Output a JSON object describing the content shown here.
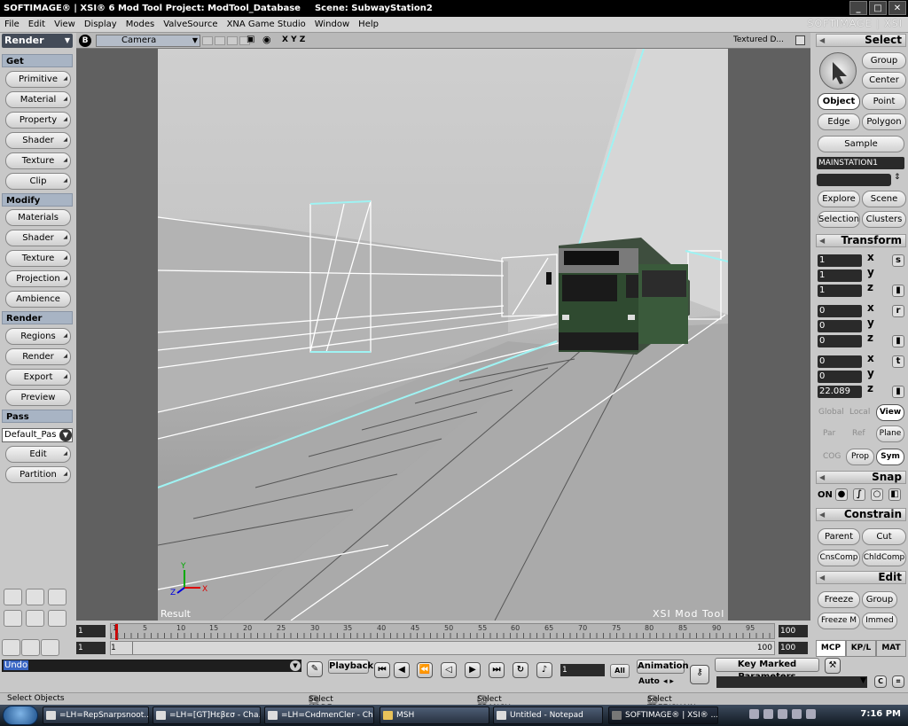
{
  "window": {
    "title": "SOFTIMAGE® | XSI® 6 Mod Tool Project: ModTool_Database",
    "scene": "Scene: SubwayStation2",
    "brand": "SOFTIMAGE | XSI"
  },
  "menu": [
    "File",
    "Edit",
    "View",
    "Display",
    "Modes",
    "ValveSource",
    "XNA Game Studio",
    "Window",
    "Help"
  ],
  "left_panel": {
    "mode": "Render",
    "sections": {
      "get": "Get",
      "modify": "Modify",
      "render": "Render",
      "pass": "Pass"
    },
    "get_buttons": [
      "Primitive",
      "Material",
      "Property",
      "Shader",
      "Texture",
      "Clip"
    ],
    "modify_buttons": [
      "Materials",
      "Shader",
      "Texture",
      "Projection",
      "Ambience"
    ],
    "render_buttons": [
      "Regions",
      "Render",
      "Export",
      "Preview"
    ],
    "pass_dropdown": "Default_Pas",
    "pass_buttons": [
      "Edit",
      "Partition"
    ]
  },
  "viewport": {
    "b_label": "B",
    "camera": "Camera",
    "axes": "X Y Z",
    "display_mode": "Textured D...",
    "label_left": "Result",
    "label_right": "XSI  Mod  Tool",
    "axis_y": "Y",
    "axis_x": "X",
    "axis_z": "Z",
    "destination_sign": "",
    "colors": {
      "floor": "#9c9c9c",
      "wall": "#b8b8b8",
      "train": "#2f4a30",
      "wire": "#9ff3f3"
    }
  },
  "right_panel": {
    "select": {
      "header": "Select",
      "group": "Group",
      "center": "Center",
      "object": "Object",
      "point": "Point",
      "edge": "Edge",
      "polygon": "Polygon",
      "sample": "Sample",
      "name": "MAINSTATION1",
      "explore": "Explore",
      "scene": "Scene",
      "selection": "Selection",
      "clusters": "Clusters"
    },
    "transform": {
      "header": "Transform",
      "scale": [
        "1",
        "1",
        "1"
      ],
      "rotate": [
        "0",
        "0",
        "0"
      ],
      "translate": [
        "0",
        "0",
        "22.089"
      ],
      "axis_labels": [
        "x",
        "y",
        "z"
      ],
      "side_btns": [
        "s",
        "r",
        "t"
      ],
      "global": "Global",
      "local": "Local",
      "view": "View",
      "par": "Par",
      "ref": "Ref",
      "plane": "Plane",
      "cog": "COG",
      "prop": "Prop",
      "sym": "Sym"
    },
    "snap": {
      "header": "Snap",
      "on": "ON"
    },
    "constrain": {
      "header": "Constrain",
      "parent": "Parent",
      "cut": "Cut",
      "cnscomp": "CnsComp",
      "chldcomp": "ChldComp"
    },
    "edit": {
      "header": "Edit",
      "freeze": "Freeze",
      "group": "Group",
      "freeze_m": "Freeze M",
      "immed": "Immed"
    },
    "tabs": [
      "MCP",
      "KP/L",
      "MAT"
    ]
  },
  "timeline": {
    "start": "1",
    "end": "100",
    "range_start": "1",
    "range_end": "100",
    "slider_label": "1",
    "slider_end": "100",
    "ticks": [
      "1",
      "5",
      "10",
      "15",
      "20",
      "25",
      "30",
      "35",
      "40",
      "45",
      "50",
      "55",
      "60",
      "65",
      "70",
      "75",
      "80",
      "85",
      "90",
      "95"
    ]
  },
  "command": {
    "undo": "Undo",
    "playback": "Playback",
    "frame_field": "1",
    "all": "All",
    "animation": "Animation",
    "auto": "Auto",
    "key_marked": "Key Marked Parameters"
  },
  "status": {
    "left": "Select Objects",
    "l_label": "L",
    "l_text": "Select NODE",
    "m_label": "M",
    "m_text": "Select BRANCH",
    "r_label": "R",
    "r_text": "Select TREE/CHAIN"
  },
  "taskbar": {
    "tasks": [
      "=LH=RepSnarpsnoot...",
      "=LH=[GT]Hεβεσ - Cha...",
      "=LH=CнdmenCler - Ch...",
      "MSH",
      "Untitled - Notepad",
      "SOFTIMAGE® | XSI® ..."
    ],
    "clock": "7:16 PM"
  }
}
